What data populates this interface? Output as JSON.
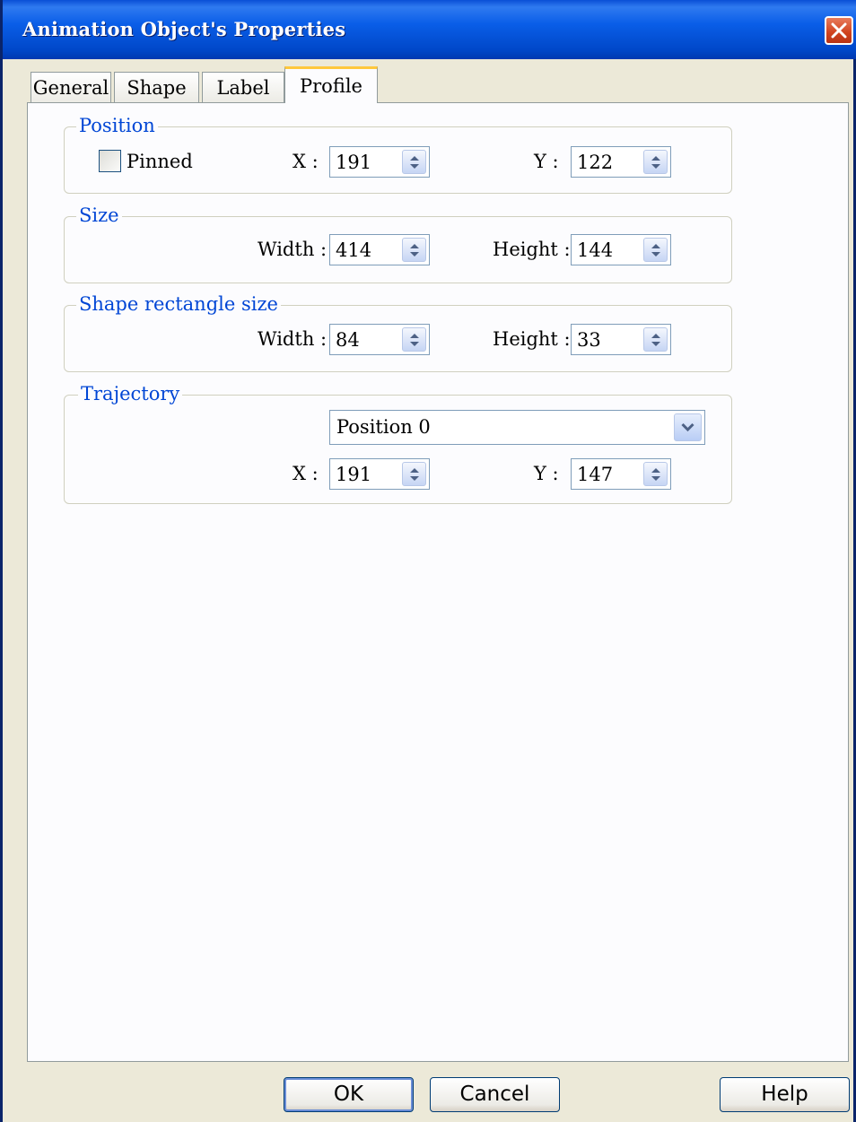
{
  "window": {
    "title": "Animation Object's Properties"
  },
  "tabs": [
    "General",
    "Shape",
    "Label",
    "Profile"
  ],
  "active_tab": "Profile",
  "position": {
    "legend": "Position",
    "pinned_label": "Pinned",
    "pinned_checked": false,
    "x_label": "X :",
    "x_value": "191",
    "y_label": "Y :",
    "y_value": "122"
  },
  "size": {
    "legend": "Size",
    "width_label": "Width :",
    "width_value": "414",
    "height_label": "Height :",
    "height_value": "144"
  },
  "shape_rect": {
    "legend": "Shape rectangle size",
    "width_label": "Width :",
    "width_value": "84",
    "height_label": "Height :",
    "height_value": "33"
  },
  "trajectory": {
    "legend": "Trajectory",
    "selected": "Position 0",
    "x_label": "X :",
    "x_value": "191",
    "y_label": "Y :",
    "y_value": "147"
  },
  "buttons": {
    "ok": "OK",
    "cancel": "Cancel",
    "help": "Help"
  }
}
